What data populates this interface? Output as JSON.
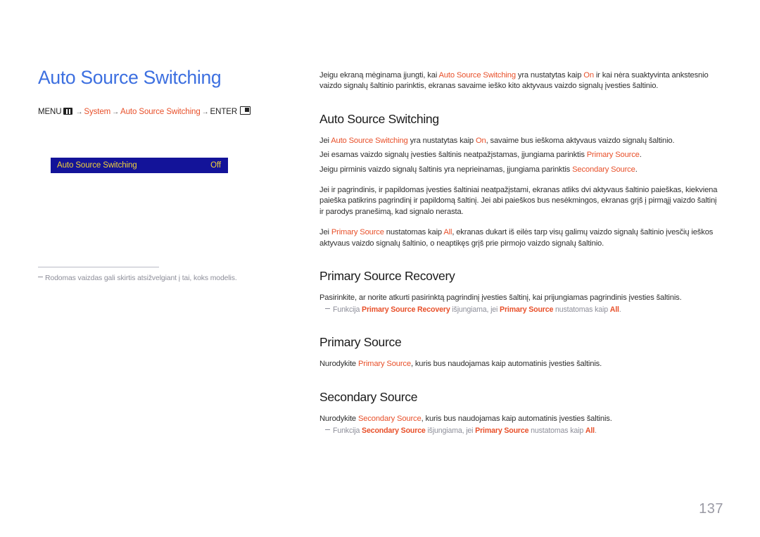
{
  "document": {
    "title": "Auto Source Switching",
    "page_number": "137"
  },
  "breadcrumb": {
    "menu_label": "MENU",
    "menu_icon": "menu-grid-icon",
    "arrow": "→",
    "item_system": "System",
    "item_auto_source_switching": "Auto Source Switching",
    "enter_label": "ENTER",
    "enter_icon": "enter-key-icon"
  },
  "osd": {
    "label": "Auto Source Switching",
    "value": "Off",
    "bg_color": "#131399",
    "text_color": "#f2d23a"
  },
  "left_note": {
    "dash": "―",
    "text": "Rodomas vaizdas gali skirtis atsižvelgiant į tai, koks modelis."
  },
  "intro": {
    "part1": "Jeigu ekraną mėginama įjungti, kai ",
    "hl1": "Auto Source Switching",
    "part2": " yra nustatytas kaip ",
    "hl2": "On",
    "part3": " ir kai nėra suaktyvinta ankstesnio vaizdo signalų šaltinio parinktis, ekranas savaime ieško kito aktyvaus vaizdo signalų įvesties šaltinio."
  },
  "sections": [
    {
      "heading": "Auto Source Switching",
      "paragraphs": [
        {
          "part1": "Jei ",
          "hl1": "Auto Source Switching",
          "part2": " yra nustatytas kaip ",
          "hl2": "On",
          "part3": ", savaime bus ieškoma aktyvaus vaizdo signalų šaltinio."
        },
        {
          "part1": "Jei esamas vaizdo signalų įvesties šaltinis neatpažįstamas, įjungiama parinktis ",
          "hl1": "Primary Source",
          "part2": "."
        },
        {
          "part1": "Jeigu pirminis vaizdo signalų šaltinis yra neprieinamas, įjungiama parinktis ",
          "hl1": "Secondary Source",
          "part2": "."
        },
        {
          "part1": "Jei ir pagrindinis, ir papildomas įvesties šaltiniai neatpažįstami, ekranas atliks dvi aktyvaus šaltinio paieškas, kiekviena paieška patikrins pagrindinį ir papildomą šaltinį. Jei abi paieškos bus nesėkmingos, ekranas grįš į pirmąjį vaizdo šaltinį ir parodys pranešimą, kad signalo nerasta."
        },
        {
          "part1": "Jei ",
          "hl1": "Primary Source",
          "part2": " nustatomas kaip ",
          "hl2": "All",
          "part3": ", ekranas dukart iš eilės tarp visų galimų vaizdo signalų šaltinio įvesčių ieškos aktyvaus vaizdo signalų šaltinio, o neaptikęs grįš prie pirmojo vaizdo signalų šaltinio."
        }
      ]
    },
    {
      "heading": "Primary Source Recovery",
      "paragraphs": [
        {
          "part1": "Pasirinkite, ar norite atkurti pasirinktą pagrindinį įvesties šaltinį, kai prijungiamas pagrindinis įvesties šaltinis."
        }
      ],
      "note": {
        "dash": "―",
        "part1": "Funkcija ",
        "hl1": "Primary Source Recovery",
        "part2": " išjungiama, jei ",
        "hl2": "Primary Source",
        "part3": " nustatomas kaip ",
        "hl3": "All",
        "part4": "."
      }
    },
    {
      "heading": "Primary Source",
      "paragraphs": [
        {
          "part1": "Nurodykite ",
          "hl1": "Primary Source",
          "part2": ", kuris bus naudojamas kaip automatinis įvesties šaltinis."
        }
      ]
    },
    {
      "heading": "Secondary Source",
      "paragraphs": [
        {
          "part1": "Nurodykite ",
          "hl1": "Secondary Source",
          "part2": ", kuris bus naudojamas kaip automatinis įvesties šaltinis."
        }
      ],
      "note": {
        "dash": "―",
        "part1": "Funkcija ",
        "hl1": "Secondary Source",
        "part2": " išjungiama, jei ",
        "hl2": "Primary Source",
        "part3": " nustatomas kaip ",
        "hl3": "All",
        "part4": "."
      }
    }
  ],
  "colors": {
    "title_blue": "#3c6fe0",
    "accent_orange": "#e8502a",
    "body_text": "#2f2f2f",
    "muted": "#8d8e99"
  }
}
